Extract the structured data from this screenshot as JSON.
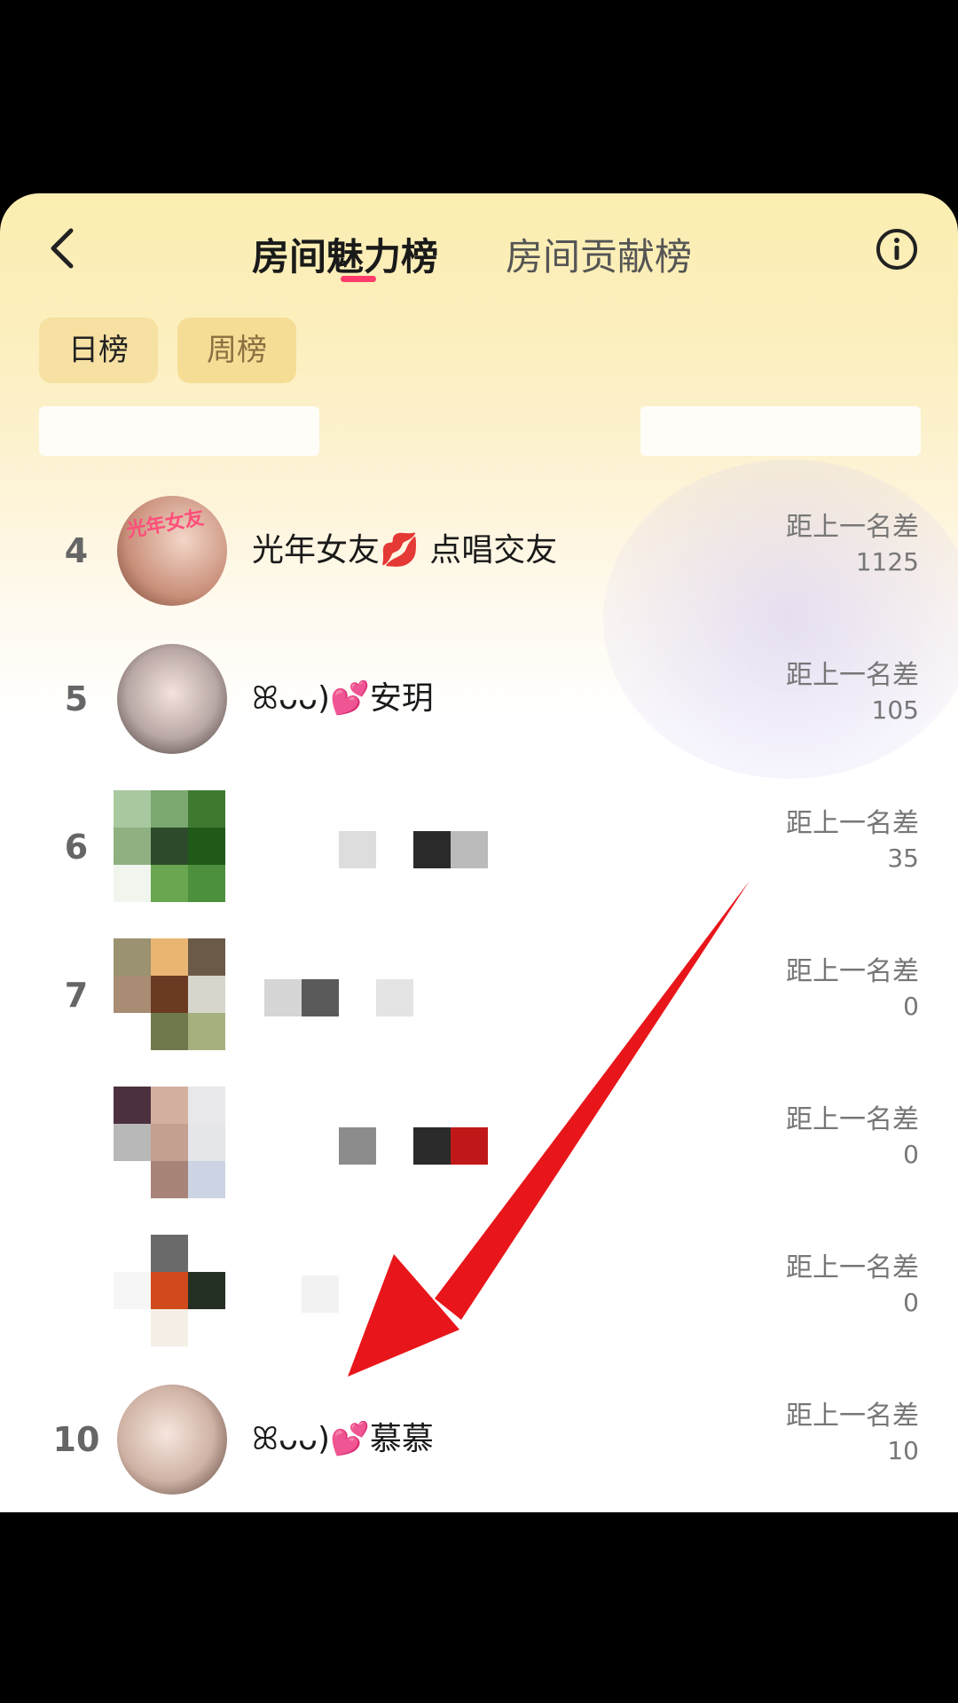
{
  "header": {
    "tabs": [
      {
        "label": "房间魅力榜",
        "active": true
      },
      {
        "label": "房间贡献榜",
        "active": false
      }
    ]
  },
  "filters": [
    {
      "label": "日榜",
      "active": true
    },
    {
      "label": "周榜",
      "active": false
    }
  ],
  "rows": [
    {
      "rank": "4",
      "name": "光年女友💋 点唱交友",
      "gap_label": "距上一名差",
      "gap_value": "1125"
    },
    {
      "rank": "5",
      "name": "ꕤᴗᴗ)💕安玥",
      "gap_label": "距上一名差",
      "gap_value": "105"
    },
    {
      "rank": "6",
      "name": "",
      "gap_label": "距上一名差",
      "gap_value": "35"
    },
    {
      "rank": "7",
      "name": "",
      "gap_label": "距上一名差",
      "gap_value": "0"
    },
    {
      "rank": "",
      "name": "",
      "gap_label": "距上一名差",
      "gap_value": "0"
    },
    {
      "rank": "",
      "name": "",
      "gap_label": "距上一名差",
      "gap_value": "0"
    },
    {
      "rank": "10",
      "name": "ꕤᴗᴗ)💕慕慕",
      "gap_label": "距上一名差",
      "gap_value": "10"
    }
  ],
  "colors": {
    "accent_underline": "#ff3b6b",
    "annotation_arrow": "#e8161a"
  },
  "icons": {
    "back": "chevron-left-icon",
    "info": "info-icon"
  }
}
